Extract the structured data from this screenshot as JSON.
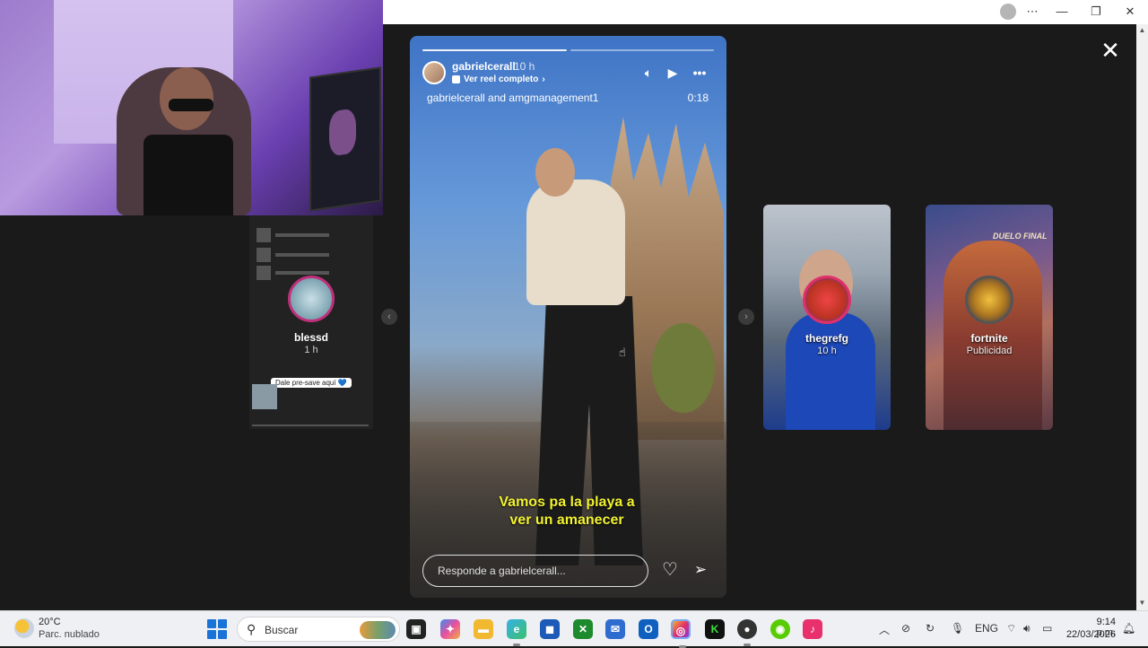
{
  "story": {
    "username": "gabrielcerall",
    "time": "10 h",
    "reel_link": "Ver reel completo",
    "collab": "gabrielcerall and amgmanagement1",
    "duration": "0:18",
    "caption_line1": "Vamos pa la playa a",
    "caption_line2": "ver un amanecer",
    "reply_placeholder": "Responde a gabrielcerall...",
    "progress_segments": 2,
    "progress_filled": 1
  },
  "prev_story": {
    "name": "blessd",
    "time": "1 h",
    "pill": "Dale pre-save aquí 💙"
  },
  "side_stories": [
    {
      "name": "thegrefg",
      "sub": "10 h"
    },
    {
      "name": "fortnite",
      "sub": "Publicidad",
      "title": "DUELO FINAL"
    }
  ],
  "taskbar": {
    "weather_temp": "20°C",
    "weather_desc": "Parc. nublado",
    "search": "Buscar",
    "lang": "ENG",
    "time": "9:14 p.m.",
    "date": "22/03/2026"
  },
  "icons": {
    "close": "close-icon",
    "volume": "volume-icon",
    "play": "play-icon",
    "more": "more-icon",
    "like": "heart-icon",
    "share": "send-icon"
  }
}
